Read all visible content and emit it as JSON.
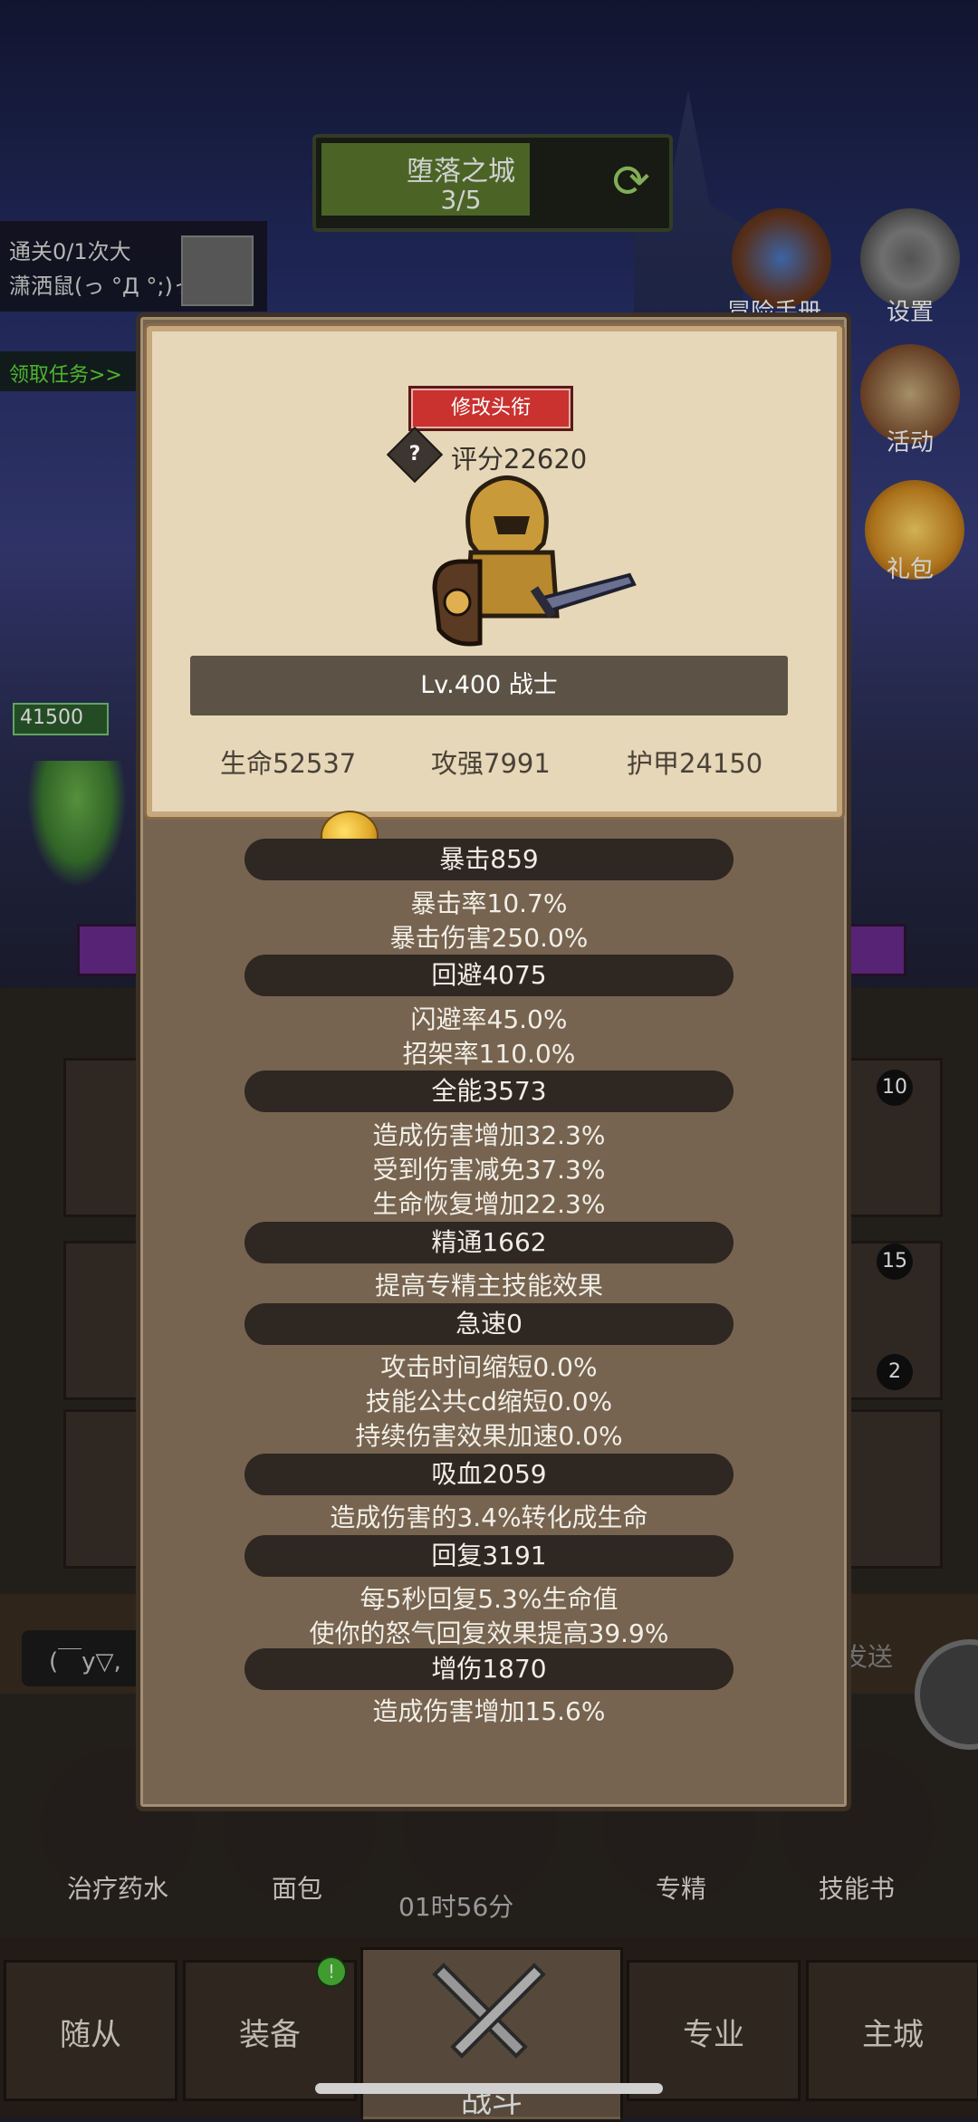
{
  "stage": {
    "title": "堕落之城",
    "progress": "3/5"
  },
  "quest": {
    "line1": "通关0/1次大",
    "line2": "潇洒鼠(っ °Д °;)っ",
    "claim": "领取任务>>"
  },
  "side_menu": [
    {
      "label": "冒险手册"
    },
    {
      "label": "设置"
    },
    {
      "label": "活动"
    },
    {
      "label": "礼包"
    }
  ],
  "player_hp": "41500",
  "slot_badges": {
    "slot1": "10",
    "slot2": "15",
    "slot3": "2"
  },
  "chat": {
    "input_text": "(￣y▽,",
    "send_label": "发送"
  },
  "quick_items": [
    {
      "label": "治疗药水"
    },
    {
      "label": "面包"
    },
    {
      "label": "专精"
    },
    {
      "label": "技能书"
    }
  ],
  "timer": "01时56分",
  "nav": [
    {
      "label": "随从"
    },
    {
      "label": "装备"
    },
    {
      "label": "战斗"
    },
    {
      "label": "专业"
    },
    {
      "label": "主城"
    }
  ],
  "nav_notify": "!",
  "modal": {
    "edit_title_button": "修改头衔",
    "help_glyph": "?",
    "score": "评分22620",
    "level": "Lv.400 战士",
    "top_stats": [
      "生命52537",
      "攻强7991",
      "护甲24150"
    ],
    "sections": [
      {
        "title": "暴击859",
        "details": [
          "暴击率10.7%",
          "暴击伤害250.0%"
        ]
      },
      {
        "title": "回避4075",
        "details": [
          "闪避率45.0%",
          "招架率110.0%"
        ]
      },
      {
        "title": "全能3573",
        "details": [
          "造成伤害增加32.3%",
          "受到伤害减免37.3%",
          "生命恢复增加22.3%"
        ]
      },
      {
        "title": "精通1662",
        "details": [
          "提高专精主技能效果"
        ]
      },
      {
        "title": "急速0",
        "details": [
          "攻击时间缩短0.0%",
          "技能公共cd缩短0.0%",
          "持续伤害效果加速0.0%"
        ]
      },
      {
        "title": "吸血2059",
        "details": [
          "造成伤害的3.4%转化成生命"
        ]
      },
      {
        "title": "回复3191",
        "details": [
          "每5秒回复5.3%生命值",
          "使你的怒气回复效果提高39.9%"
        ]
      },
      {
        "title": "增伤1870",
        "details": [
          "造成伤害增加15.6%"
        ]
      }
    ]
  },
  "colors": {
    "accent_red": "#c9322f",
    "paper": "#e6d7b8",
    "panel": "#766450",
    "section_bar": "#2e2722"
  }
}
